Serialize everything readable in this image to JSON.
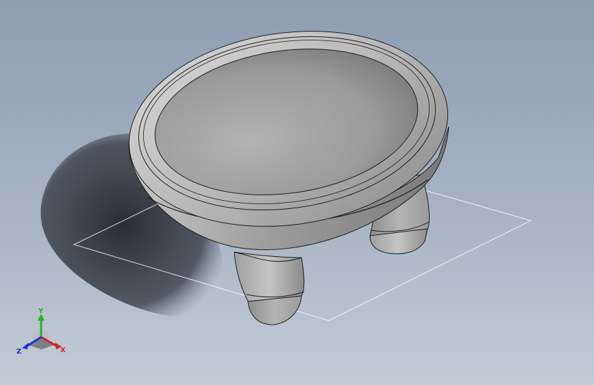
{
  "viewport": {
    "background_top": "#8d9db2",
    "background_bottom": "#c3cbd6",
    "model_color": "#a9a9a9",
    "edge_color": "#1a1a1a",
    "shadow_color": "#2c2f34",
    "plane_color": "#ffffff"
  },
  "triad": {
    "x_label": "X",
    "y_label": "Y",
    "z_label": "Z",
    "x_color": "#d42020",
    "y_color": "#22b022",
    "z_color": "#2030d0"
  }
}
